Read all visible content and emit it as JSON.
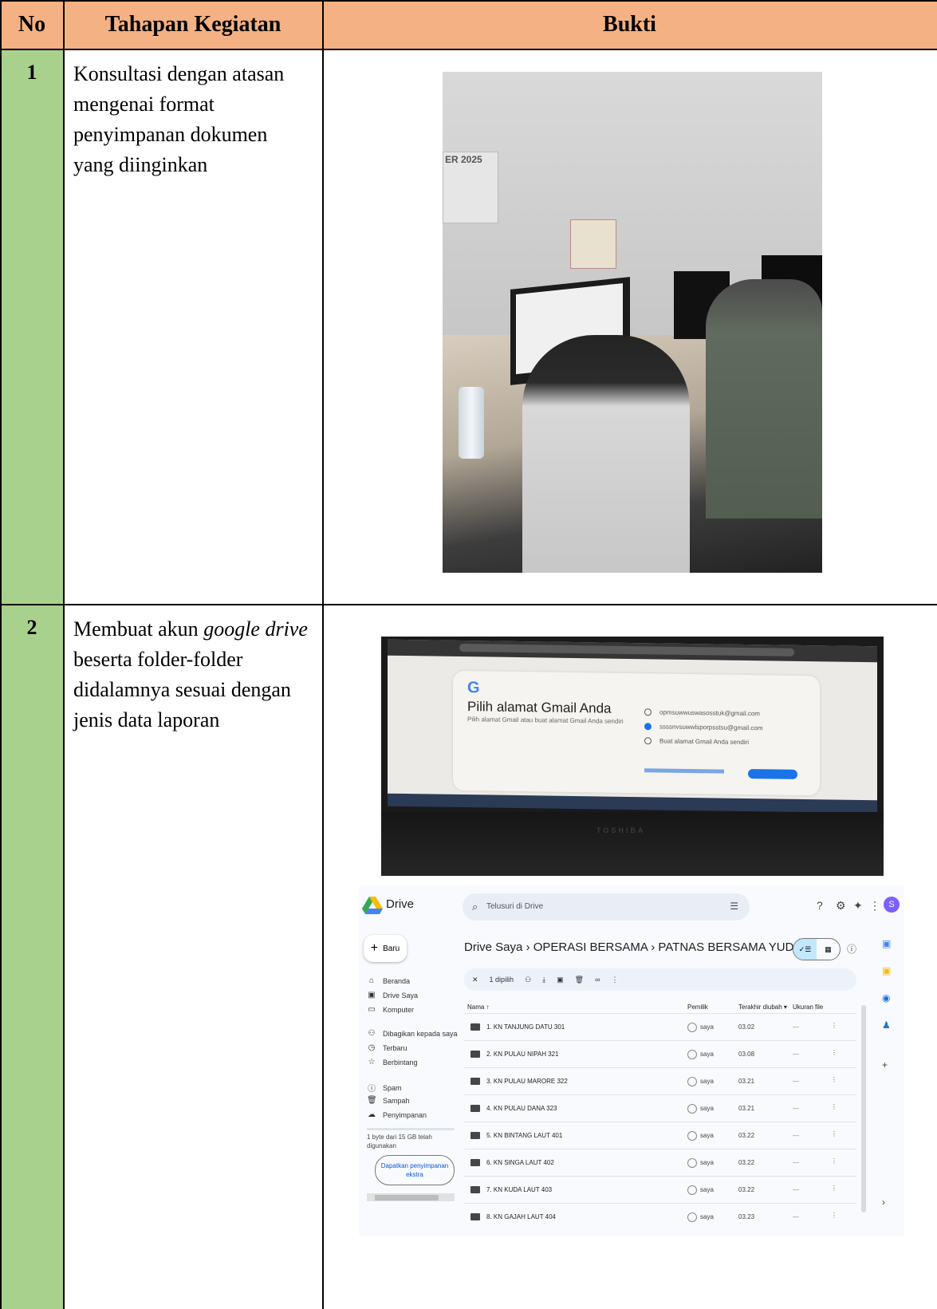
{
  "table": {
    "headers": {
      "no": "No",
      "stage": "Tahapan Kegiatan",
      "evidence": "Bukti"
    },
    "rows": [
      {
        "no": "1",
        "stage": "Konsultasi dengan atasan mengenai format penyimpanan dokumen yang diinginkan",
        "photo_caption": "ER 2025"
      },
      {
        "no": "2",
        "stage_part1": "Membuat akun ",
        "stage_italic1": "google drive",
        "stage_part2": " beserta folder-folder didalamnya sesuai dengan jenis data laporan"
      }
    ]
  },
  "gmail_photo": {
    "g_logo": "G",
    "title": "Pilih alamat Gmail Anda",
    "subtitle": "Pilih alamat Gmail atau buat alamat Gmail Anda sendiri",
    "options": [
      "opmsuwwuswasosstuk@gmail.com",
      "ssssnvsuwwlsporpsstsu@gmail.com",
      "Buat alamat Gmail Anda sendiri"
    ],
    "selected_index": 1,
    "laptop_brand": "TOSHIBA"
  },
  "drive": {
    "app_name": "Drive",
    "search_placeholder": "Telusuri di Drive",
    "new_button": "Baru",
    "nav": [
      {
        "icon": "⌂",
        "label": "Beranda"
      },
      {
        "icon": "▣",
        "label": "Drive Saya"
      },
      {
        "icon": "▭",
        "label": "Komputer"
      },
      {
        "icon": "⚇",
        "label": "Dibagikan kepada saya"
      },
      {
        "icon": "◷",
        "label": "Terbaru"
      },
      {
        "icon": "☆",
        "label": "Berbintang"
      },
      {
        "icon": "ⓘ",
        "label": "Spam"
      },
      {
        "icon": "🗑",
        "label": "Sampah"
      },
      {
        "icon": "☁",
        "label": "Penyimpanan"
      }
    ],
    "storage_text": "1 byte dari 15 GB telah digunakan",
    "storage_button": "Dapatkan penyimpanan ekstra",
    "breadcrumb": "Drive Saya  ›  OPERASI BERSAMA  ›  PATNAS BERSAMA YUD...  ▾",
    "selection_label": "1 dipilih",
    "columns": {
      "name": "Nama  ↑",
      "owner": "Pemilik",
      "modified": "Terakhir diubah ▾",
      "size": "Ukuran file"
    },
    "files": [
      {
        "name": "1. KN TANJUNG DATU 301",
        "owner": "saya",
        "modified": "03.02",
        "size": "—"
      },
      {
        "name": "2. KN PULAU NIPAH 321",
        "owner": "saya",
        "modified": "03.08",
        "size": "—"
      },
      {
        "name": "3. KN PULAU MARORE 322",
        "owner": "saya",
        "modified": "03.21",
        "size": "—"
      },
      {
        "name": "4. KN PULAU DANA 323",
        "owner": "saya",
        "modified": "03.21",
        "size": "—"
      },
      {
        "name": "5. KN BINTANG LAUT 401",
        "owner": "saya",
        "modified": "03.22",
        "size": "—"
      },
      {
        "name": "6. KN SINGA LAUT 402",
        "owner": "saya",
        "modified": "03.22",
        "size": "—"
      },
      {
        "name": "7. KN KUDA LAUT 403",
        "owner": "saya",
        "modified": "03.22",
        "size": "—"
      },
      {
        "name": "8. KN GAJAH LAUT 404",
        "owner": "saya",
        "modified": "03.23",
        "size": "—"
      }
    ],
    "avatar_letter": "S",
    "colors": {
      "accent": "#1a73e8",
      "header_bg": "#f4b183",
      "no_col_bg": "#a9d18e"
    }
  }
}
